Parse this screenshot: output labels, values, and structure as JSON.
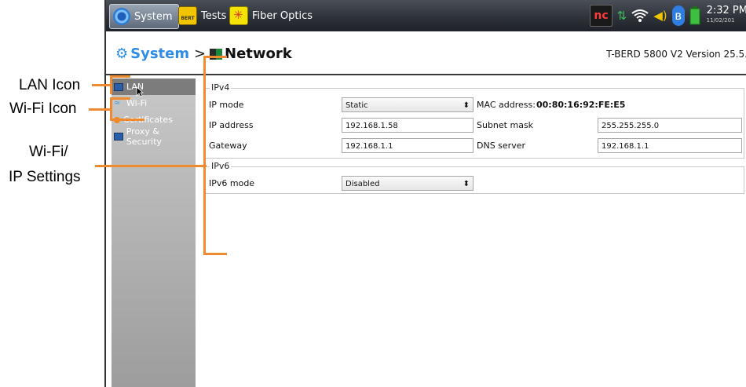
{
  "annotations": {
    "lan_icon": "LAN Icon",
    "wifi_icon": "Wi-Fi Icon",
    "settings_line1": "Wi-Fi/",
    "settings_line2": "IP Settings"
  },
  "taskbar": {
    "system": "System",
    "tests": "Tests",
    "fiber_optics": "Fiber Optics",
    "bert_badge": "BERT",
    "tray": {
      "nc": "nc",
      "time": "2:32 PM",
      "date": "11/02/201"
    }
  },
  "title": {
    "system": "System",
    "separator": ">",
    "network": "Network",
    "version": "T-BERD 5800 V2 Version 25.5."
  },
  "sidebar": {
    "items": [
      {
        "label": "LAN",
        "icon": "lan-icon",
        "selected": true
      },
      {
        "label": "Wi-Fi",
        "icon": "wifi-icon"
      },
      {
        "label": "Certificates",
        "icon": "certificate-icon"
      },
      {
        "label": "Proxy & Security",
        "icon": "proxy-icon"
      }
    ]
  },
  "ipv4": {
    "title": "IPv4",
    "ip_mode_label": "IP mode",
    "ip_mode_value": "Static",
    "mac_label": "MAC address:",
    "mac_value": "00:80:16:92:FE:E5",
    "ip_address_label": "IP address",
    "ip_address_value": "192.168.1.58",
    "subnet_label": "Subnet mask",
    "subnet_value": "255.255.255.0",
    "gateway_label": "Gateway",
    "gateway_value": "192.168.1.1",
    "dns_label": "DNS server",
    "dns_value": "192.168.1.1"
  },
  "ipv6": {
    "title": "IPv6",
    "mode_label": "IPv6 mode",
    "mode_value": "Disabled"
  },
  "colors": {
    "accent": "#f08a30",
    "link_blue": "#2f8de4"
  }
}
